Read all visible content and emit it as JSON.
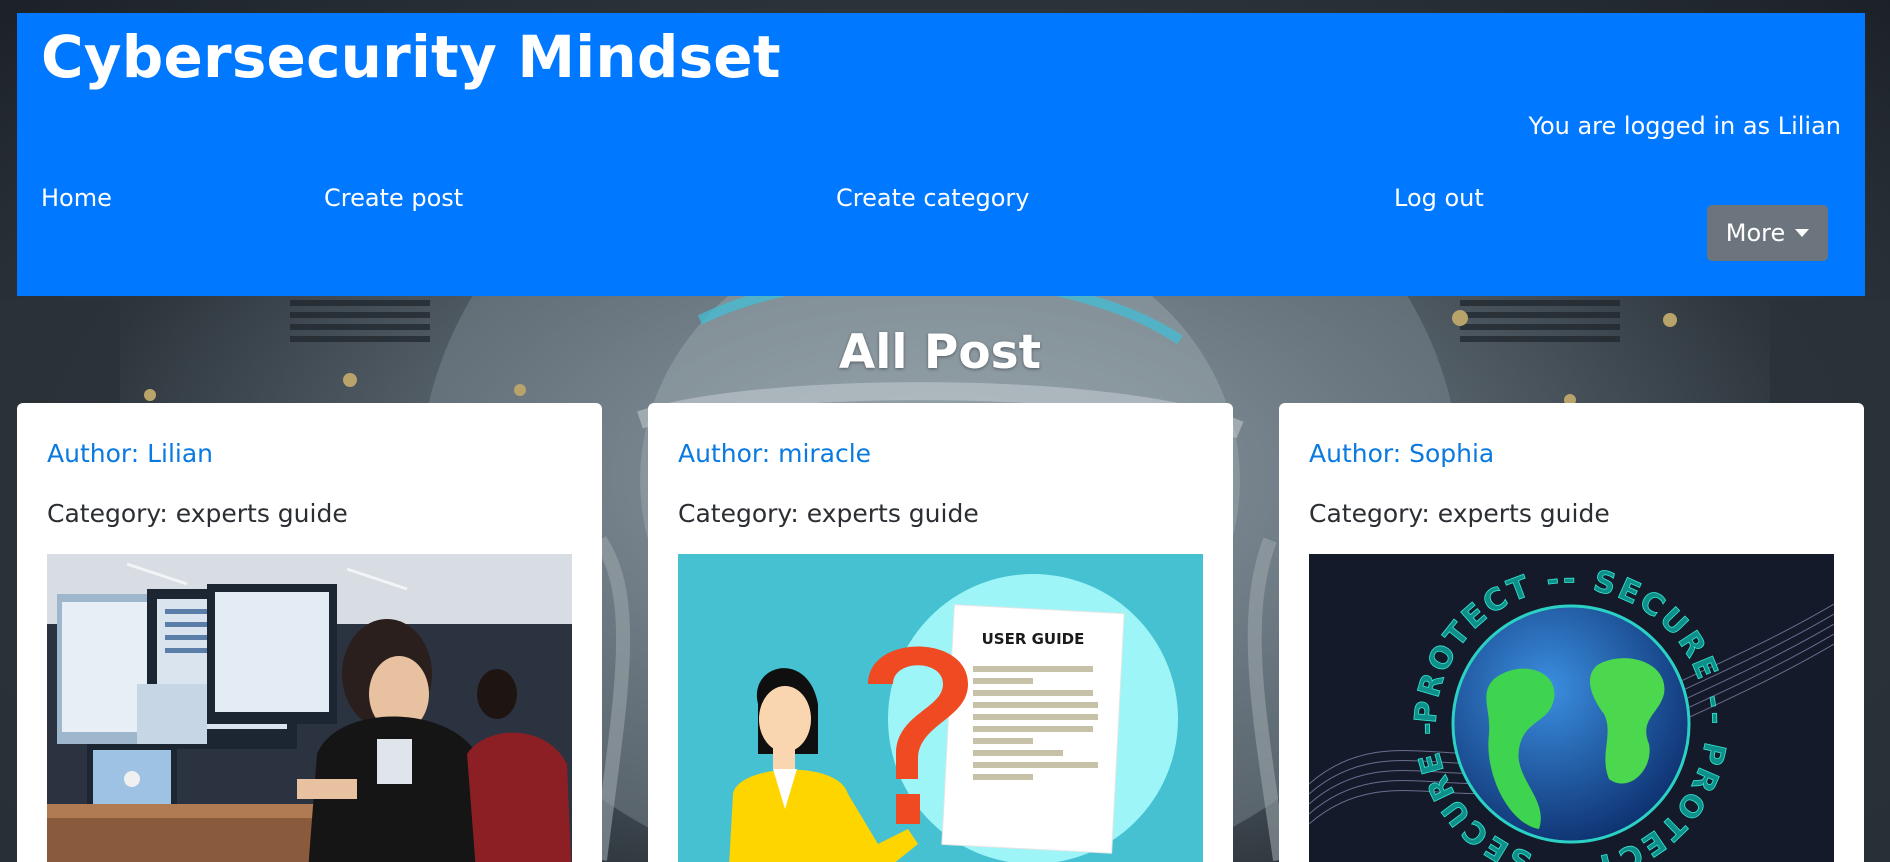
{
  "header": {
    "site_title": "Cybersecurity Mindset",
    "login_status": "You are logged in as Lilian",
    "nav": [
      "Home",
      "Create post",
      "Create category",
      "Log out"
    ],
    "more_label": "More"
  },
  "page_heading": "All Post",
  "posts": [
    {
      "author": "Author: Lilian",
      "category": "Category: experts guide",
      "image_icon": "developer-workstation-image"
    },
    {
      "author": "Author: miracle",
      "category": "Category: experts guide",
      "image_icon": "user-guide-image",
      "image_text": "USER GUIDE"
    },
    {
      "author": "Author: Sophia",
      "category": "Category: experts guide",
      "image_icon": "globe-security-image",
      "image_text": "PROTECT -- SECURE -- PROTECT -- SECURE --"
    }
  ],
  "colors": {
    "header_bg": "#0078ff",
    "link": "#0a7ae0",
    "more_button": "#6c757d"
  }
}
